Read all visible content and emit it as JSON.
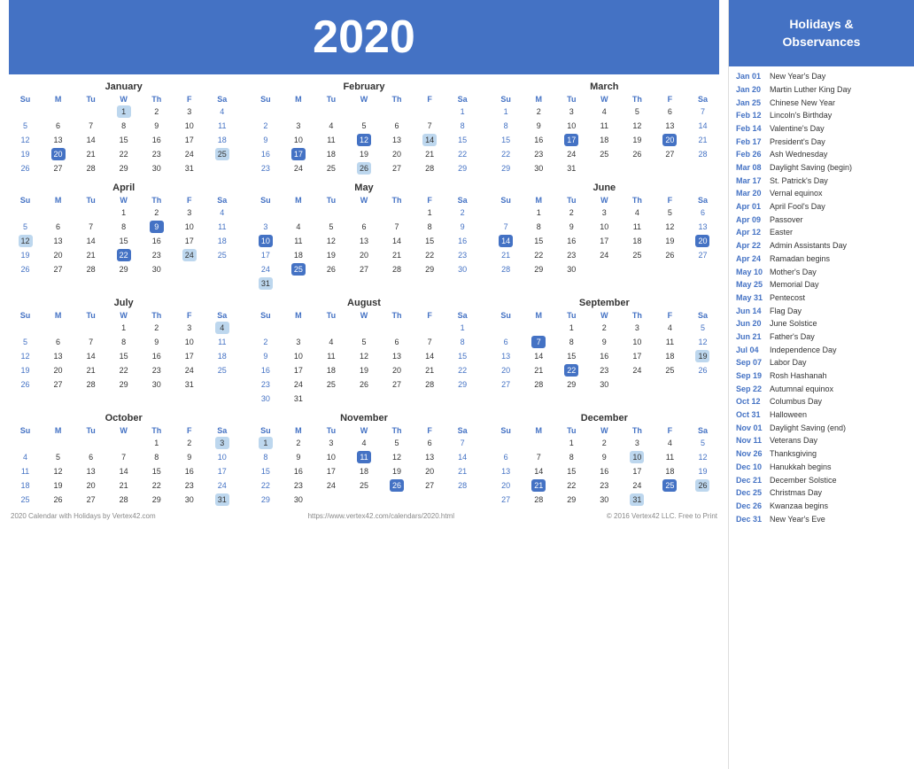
{
  "year": "2020",
  "header_title": "Holidays &\nObservances",
  "footer": {
    "left": "2020 Calendar with Holidays by Vertex42.com",
    "center": "https://www.vertex42.com/calendars/2020.html",
    "right": "© 2016 Vertex42 LLC. Free to Print"
  },
  "months": [
    {
      "name": "January",
      "days_of_week": [
        "Su",
        "M",
        "Tu",
        "W",
        "Th",
        "F",
        "Sa"
      ],
      "weeks": [
        [
          "",
          "",
          "",
          "1",
          "2",
          "3",
          "4"
        ],
        [
          "5",
          "6",
          "7",
          "8",
          "9",
          "10",
          "11"
        ],
        [
          "12",
          "13",
          "14",
          "15",
          "16",
          "17",
          "18"
        ],
        [
          "19",
          "20",
          "21",
          "22",
          "23",
          "24",
          "25"
        ],
        [
          "26",
          "27",
          "28",
          "29",
          "30",
          "31",
          ""
        ]
      ],
      "highlighted": [
        "20"
      ],
      "light_blue": [
        "1",
        "25"
      ]
    },
    {
      "name": "February",
      "days_of_week": [
        "Su",
        "M",
        "Tu",
        "W",
        "Th",
        "F",
        "Sa"
      ],
      "weeks": [
        [
          "",
          "",
          "",
          "",
          "",
          "",
          "1"
        ],
        [
          "2",
          "3",
          "4",
          "5",
          "6",
          "7",
          "8"
        ],
        [
          "9",
          "10",
          "11",
          "12",
          "13",
          "14",
          "15"
        ],
        [
          "16",
          "17",
          "18",
          "19",
          "20",
          "21",
          "22"
        ],
        [
          "23",
          "24",
          "25",
          "26",
          "27",
          "28",
          "29"
        ]
      ],
      "highlighted": [
        "12",
        "17"
      ],
      "light_blue": [
        "14",
        "26"
      ]
    },
    {
      "name": "March",
      "days_of_week": [
        "Su",
        "M",
        "Tu",
        "W",
        "Th",
        "F",
        "Sa"
      ],
      "weeks": [
        [
          "1",
          "2",
          "3",
          "4",
          "5",
          "6",
          "7"
        ],
        [
          "8",
          "9",
          "10",
          "11",
          "12",
          "13",
          "14"
        ],
        [
          "15",
          "16",
          "17",
          "18",
          "19",
          "20",
          "21"
        ],
        [
          "22",
          "23",
          "24",
          "25",
          "26",
          "27",
          "28"
        ],
        [
          "29",
          "30",
          "31",
          "",
          "",
          "",
          ""
        ]
      ],
      "highlighted": [
        "17",
        "20"
      ],
      "light_blue": []
    },
    {
      "name": "April",
      "days_of_week": [
        "Su",
        "M",
        "Tu",
        "W",
        "Th",
        "F",
        "Sa"
      ],
      "weeks": [
        [
          "",
          "",
          "",
          "1",
          "2",
          "3",
          "4"
        ],
        [
          "5",
          "6",
          "7",
          "8",
          "9",
          "10",
          "11"
        ],
        [
          "12",
          "13",
          "14",
          "15",
          "16",
          "17",
          "18"
        ],
        [
          "19",
          "20",
          "21",
          "22",
          "23",
          "24",
          "25"
        ],
        [
          "26",
          "27",
          "28",
          "29",
          "30",
          "",
          ""
        ]
      ],
      "highlighted": [
        "9",
        "22"
      ],
      "light_blue": [
        "12",
        "24"
      ]
    },
    {
      "name": "May",
      "days_of_week": [
        "Su",
        "M",
        "Tu",
        "W",
        "Th",
        "F",
        "Sa"
      ],
      "weeks": [
        [
          "",
          "",
          "",
          "",
          "",
          "1",
          "2"
        ],
        [
          "3",
          "4",
          "5",
          "6",
          "7",
          "8",
          "9"
        ],
        [
          "10",
          "11",
          "12",
          "13",
          "14",
          "15",
          "16"
        ],
        [
          "17",
          "18",
          "19",
          "20",
          "21",
          "22",
          "23"
        ],
        [
          "24",
          "25",
          "26",
          "27",
          "28",
          "29",
          "30"
        ],
        [
          "31",
          "",
          "",
          "",
          "",
          "",
          ""
        ]
      ],
      "highlighted": [
        "10",
        "25"
      ],
      "light_blue": [
        "31"
      ]
    },
    {
      "name": "June",
      "days_of_week": [
        "Su",
        "M",
        "Tu",
        "W",
        "Th",
        "F",
        "Sa"
      ],
      "weeks": [
        [
          "",
          "1",
          "2",
          "3",
          "4",
          "5",
          "6"
        ],
        [
          "7",
          "8",
          "9",
          "10",
          "11",
          "12",
          "13"
        ],
        [
          "14",
          "15",
          "16",
          "17",
          "18",
          "19",
          "20"
        ],
        [
          "21",
          "22",
          "23",
          "24",
          "25",
          "26",
          "27"
        ],
        [
          "28",
          "29",
          "30",
          "",
          "",
          "",
          ""
        ]
      ],
      "highlighted": [
        "14",
        "20"
      ],
      "light_blue": []
    },
    {
      "name": "July",
      "days_of_week": [
        "Su",
        "M",
        "Tu",
        "W",
        "Th",
        "F",
        "Sa"
      ],
      "weeks": [
        [
          "",
          "",
          "",
          "1",
          "2",
          "3",
          "4"
        ],
        [
          "5",
          "6",
          "7",
          "8",
          "9",
          "10",
          "11"
        ],
        [
          "12",
          "13",
          "14",
          "15",
          "16",
          "17",
          "18"
        ],
        [
          "19",
          "20",
          "21",
          "22",
          "23",
          "24",
          "25"
        ],
        [
          "26",
          "27",
          "28",
          "29",
          "30",
          "31",
          ""
        ]
      ],
      "highlighted": [],
      "light_blue": [
        "4"
      ]
    },
    {
      "name": "August",
      "days_of_week": [
        "Su",
        "M",
        "Tu",
        "W",
        "Th",
        "F",
        "Sa"
      ],
      "weeks": [
        [
          "",
          "",
          "",
          "",
          "",
          "",
          "1"
        ],
        [
          "2",
          "3",
          "4",
          "5",
          "6",
          "7",
          "8"
        ],
        [
          "9",
          "10",
          "11",
          "12",
          "13",
          "14",
          "15"
        ],
        [
          "16",
          "17",
          "18",
          "19",
          "20",
          "21",
          "22"
        ],
        [
          "23",
          "24",
          "25",
          "26",
          "27",
          "28",
          "29"
        ],
        [
          "30",
          "31",
          "",
          "",
          "",
          "",
          ""
        ]
      ],
      "highlighted": [],
      "light_blue": []
    },
    {
      "name": "September",
      "days_of_week": [
        "Su",
        "M",
        "Tu",
        "W",
        "Th",
        "F",
        "Sa"
      ],
      "weeks": [
        [
          "",
          "",
          "1",
          "2",
          "3",
          "4",
          "5"
        ],
        [
          "6",
          "7",
          "8",
          "9",
          "10",
          "11",
          "12"
        ],
        [
          "13",
          "14",
          "15",
          "16",
          "17",
          "18",
          "19"
        ],
        [
          "20",
          "21",
          "22",
          "23",
          "24",
          "25",
          "26"
        ],
        [
          "27",
          "28",
          "29",
          "30",
          "",
          "",
          ""
        ]
      ],
      "highlighted": [
        "7",
        "22"
      ],
      "light_blue": [
        "19"
      ]
    },
    {
      "name": "October",
      "days_of_week": [
        "Su",
        "M",
        "Tu",
        "W",
        "Th",
        "F",
        "Sa"
      ],
      "weeks": [
        [
          "",
          "",
          "",
          "",
          "1",
          "2",
          "3"
        ],
        [
          "4",
          "5",
          "6",
          "7",
          "8",
          "9",
          "10"
        ],
        [
          "11",
          "12",
          "13",
          "14",
          "15",
          "16",
          "17"
        ],
        [
          "18",
          "19",
          "20",
          "21",
          "22",
          "23",
          "24"
        ],
        [
          "25",
          "26",
          "27",
          "28",
          "29",
          "30",
          "31"
        ]
      ],
      "highlighted": [],
      "light_blue": [
        "3",
        "31"
      ]
    },
    {
      "name": "November",
      "days_of_week": [
        "Su",
        "M",
        "Tu",
        "W",
        "Th",
        "F",
        "Sa"
      ],
      "weeks": [
        [
          "1",
          "2",
          "3",
          "4",
          "5",
          "6",
          "7"
        ],
        [
          "8",
          "9",
          "10",
          "11",
          "12",
          "13",
          "14"
        ],
        [
          "15",
          "16",
          "17",
          "18",
          "19",
          "20",
          "21"
        ],
        [
          "22",
          "23",
          "24",
          "25",
          "26",
          "27",
          "28"
        ],
        [
          "29",
          "30",
          "",
          "",
          "",
          "",
          ""
        ]
      ],
      "highlighted": [
        "11",
        "26"
      ],
      "light_blue": [
        "1"
      ]
    },
    {
      "name": "December",
      "days_of_week": [
        "Su",
        "M",
        "Tu",
        "W",
        "Th",
        "F",
        "Sa"
      ],
      "weeks": [
        [
          "",
          "",
          "1",
          "2",
          "3",
          "4",
          "5"
        ],
        [
          "6",
          "7",
          "8",
          "9",
          "10",
          "11",
          "12"
        ],
        [
          "13",
          "14",
          "15",
          "16",
          "17",
          "18",
          "19"
        ],
        [
          "20",
          "21",
          "22",
          "23",
          "24",
          "25",
          "26"
        ],
        [
          "27",
          "28",
          "29",
          "30",
          "31",
          "",
          ""
        ]
      ],
      "highlighted": [
        "21",
        "25"
      ],
      "light_blue": [
        "10",
        "26",
        "31"
      ]
    }
  ],
  "holidays": [
    {
      "date": "Jan 01",
      "name": "New Year's Day"
    },
    {
      "date": "Jan 20",
      "name": "Martin Luther King Day"
    },
    {
      "date": "Jan 25",
      "name": "Chinese New Year"
    },
    {
      "date": "Feb 12",
      "name": "Lincoln's Birthday"
    },
    {
      "date": "Feb 14",
      "name": "Valentine's Day"
    },
    {
      "date": "Feb 17",
      "name": "President's Day"
    },
    {
      "date": "Feb 26",
      "name": "Ash Wednesday"
    },
    {
      "date": "Mar 08",
      "name": "Daylight Saving (begin)"
    },
    {
      "date": "Mar 17",
      "name": "St. Patrick's Day"
    },
    {
      "date": "Mar 20",
      "name": "Vernal equinox"
    },
    {
      "date": "Apr 01",
      "name": "April Fool's Day"
    },
    {
      "date": "Apr 09",
      "name": "Passover"
    },
    {
      "date": "Apr 12",
      "name": "Easter"
    },
    {
      "date": "Apr 22",
      "name": "Admin Assistants Day"
    },
    {
      "date": "Apr 24",
      "name": "Ramadan begins"
    },
    {
      "date": "May 10",
      "name": "Mother's Day"
    },
    {
      "date": "May 25",
      "name": "Memorial Day"
    },
    {
      "date": "May 31",
      "name": "Pentecost"
    },
    {
      "date": "Jun 14",
      "name": "Flag Day"
    },
    {
      "date": "Jun 20",
      "name": "June Solstice"
    },
    {
      "date": "Jun 21",
      "name": "Father's Day"
    },
    {
      "date": "Jul 04",
      "name": "Independence Day"
    },
    {
      "date": "Sep 07",
      "name": "Labor Day"
    },
    {
      "date": "Sep 19",
      "name": "Rosh Hashanah"
    },
    {
      "date": "Sep 22",
      "name": "Autumnal equinox"
    },
    {
      "date": "Oct 12",
      "name": "Columbus Day"
    },
    {
      "date": "Oct 31",
      "name": "Halloween"
    },
    {
      "date": "Nov 01",
      "name": "Daylight Saving (end)"
    },
    {
      "date": "Nov 11",
      "name": "Veterans Day"
    },
    {
      "date": "Nov 26",
      "name": "Thanksgiving"
    },
    {
      "date": "Dec 10",
      "name": "Hanukkah begins"
    },
    {
      "date": "Dec 21",
      "name": "December Solstice"
    },
    {
      "date": "Dec 25",
      "name": "Christmas Day"
    },
    {
      "date": "Dec 26",
      "name": "Kwanzaa begins"
    },
    {
      "date": "Dec 31",
      "name": "New Year's Eve"
    }
  ]
}
